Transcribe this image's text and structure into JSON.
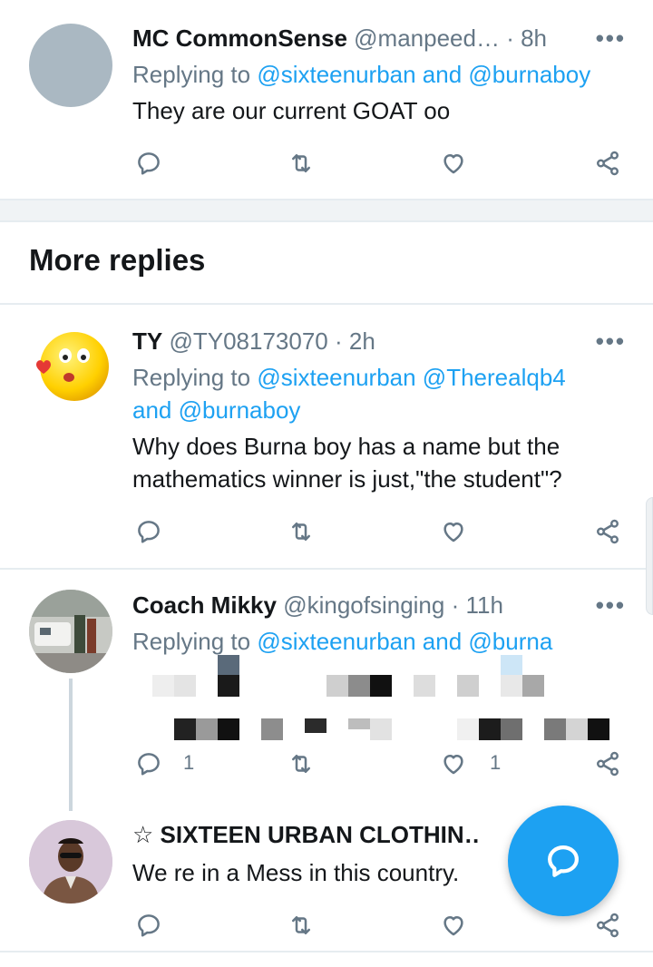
{
  "tweets": [
    {
      "name": "MC CommonSense",
      "handle": "@manpeed…",
      "time": "· 8h",
      "replying_prefix": "Replying to ",
      "replying_targets": "@sixteenurban and @burnaboy",
      "text": "They are our current GOAT oo",
      "reply_count": "",
      "like_count": ""
    },
    {
      "name": "TY",
      "handle": "@TY08173070",
      "time": "· 2h",
      "replying_prefix": "Replying to ",
      "replying_line1": "@sixteenurban @Therealqb4",
      "replying_line2": "and @burnaboy",
      "text_line1": "Why does Burna boy has a name but the",
      "text_line2": "mathematics winner is just,\"the student\"?"
    },
    {
      "name": "Coach Mikky",
      "handle": "@kingofsinging",
      "time": "· 11h",
      "replying_prefix": "Replying to ",
      "replying_targets": "@sixteenurban and @burna",
      "reply_count": "1",
      "like_count": "1"
    },
    {
      "name": "☆ SIXTEEN URBAN CLOTHIN…",
      "text": "We re in a Mess in this country."
    }
  ],
  "section": {
    "more_replies": "More replies"
  },
  "more_label": "•••",
  "icons": {
    "reply": "reply-icon",
    "retweet": "retweet-icon",
    "like": "like-icon",
    "share": "share-icon",
    "compose": "compose-reply-icon"
  },
  "colors": {
    "accent": "#1da1f2",
    "muted": "#657786",
    "text": "#14171a",
    "divider": "#e6ecf0"
  }
}
